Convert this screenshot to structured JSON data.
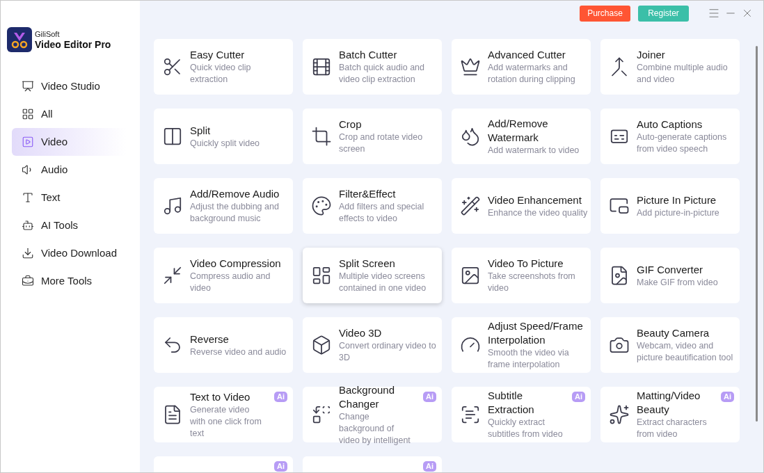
{
  "app": {
    "brand": "GiliSoft",
    "product": "Video Editor Pro"
  },
  "topbar": {
    "buttons": [
      {
        "label": "Purchase",
        "kind": "purchase"
      },
      {
        "label": "Register",
        "kind": "register"
      }
    ]
  },
  "sidebar": {
    "items": [
      {
        "label": "Video Studio",
        "selected": false
      },
      {
        "label": "All",
        "selected": false
      },
      {
        "label": "Video",
        "selected": true
      },
      {
        "label": "Audio",
        "selected": false
      },
      {
        "label": "Text",
        "selected": false
      },
      {
        "label": "AI Tools",
        "selected": false
      },
      {
        "label": "Video Download",
        "selected": false
      },
      {
        "label": "More Tools",
        "selected": false
      }
    ]
  },
  "tools": [
    {
      "title": "Easy Cutter",
      "description": "Quick video clip extraction"
    },
    {
      "title": "Batch Cutter",
      "description": "Batch quick audio and video clip extraction"
    },
    {
      "title": "Advanced Cutter",
      "description": "Add watermarks and rotation during clipping"
    },
    {
      "title": "Joiner",
      "description": "Combine multiple audio and video"
    },
    {
      "title": "Split",
      "description": "Quickly split video"
    },
    {
      "title": "Crop",
      "description": "Crop and rotate video screen"
    },
    {
      "title": "Add/Remove Watermark",
      "description": "Add watermark to video"
    },
    {
      "title": "Auto Captions",
      "description": "Auto-generate captions from video speech"
    },
    {
      "title": "Add/Remove Audio",
      "description": "Adjust the dubbing and background music"
    },
    {
      "title": "Filter&Effect",
      "description": "Add filters and special effects to video"
    },
    {
      "title": "Video Enhancement",
      "description": "Enhance the video quality"
    },
    {
      "title": "Picture In Picture",
      "description": "Add picture-in-picture"
    },
    {
      "title": "Video Compression",
      "description": "Compress audio and video"
    },
    {
      "title": "Split Screen",
      "description": "Multiple video screens contained in one video",
      "hovered": true
    },
    {
      "title": "Video To Picture",
      "description": "Take screenshots from video"
    },
    {
      "title": "GIF Converter",
      "description": "Make GIF from video"
    },
    {
      "title": "Reverse",
      "description": "Reverse video and audio"
    },
    {
      "title": "Video 3D",
      "description": "Convert ordinary video to 3D"
    },
    {
      "title": "Adjust Speed/Frame Interpolation",
      "description": "Smooth the video via frame interpolation"
    },
    {
      "title": "Beauty Camera",
      "description": "Webcam, video and picture beautification tool"
    },
    {
      "title": "Text to Video",
      "description": "Generate video with one click from text",
      "badge": "Ai"
    },
    {
      "title": "Background Changer",
      "description": "Change background of video by intelligent",
      "badge": "Ai"
    },
    {
      "title": "Subtitle Extraction",
      "description": "Quickly extract subtitles from video",
      "badge": "Ai"
    },
    {
      "title": "Matting/Video Beauty",
      "description": "Extract characters from video",
      "badge": "Ai"
    },
    {
      "badge": "Ai"
    },
    {
      "badge": "Ai"
    }
  ]
}
